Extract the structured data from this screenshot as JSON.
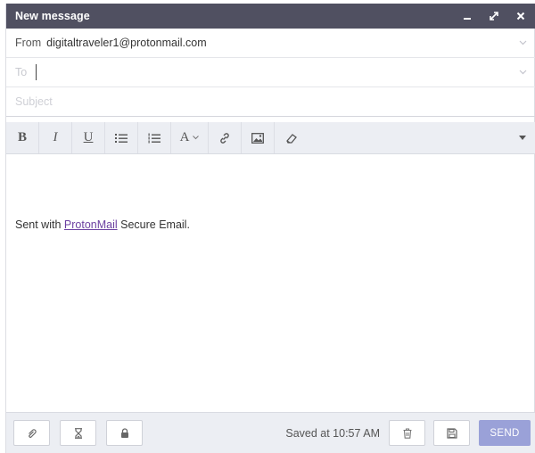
{
  "window": {
    "title": "New message",
    "controls": [
      "minimize-icon",
      "expand-icon",
      "close-icon"
    ]
  },
  "from": {
    "label": "From",
    "value": "digitaltraveler1@protonmail.com"
  },
  "to": {
    "label": "To",
    "value": ""
  },
  "subject": {
    "placeholder": "Subject",
    "value": ""
  },
  "toolbar": {
    "bold": "B",
    "italic": "I",
    "underline": "U",
    "font": "A",
    "icons": [
      "bold-icon",
      "italic-icon",
      "underline-icon",
      "bulleted-list-icon",
      "numbered-list-icon",
      "font-icon",
      "link-icon",
      "image-icon",
      "eraser-icon",
      "caret-down-icon"
    ]
  },
  "body": {
    "signature_prefix": "Sent with ",
    "signature_link": "ProtonMail",
    "signature_suffix": " Secure Email."
  },
  "footer": {
    "icons": [
      "attachment-icon",
      "hourglass-icon",
      "lock-icon",
      "trash-icon",
      "save-icon"
    ],
    "status": "Saved at 10:57 AM",
    "send_label": "SEND"
  },
  "colors": {
    "titlebar": "#505061",
    "send_button": "#9aa1d8",
    "link": "#6b3fa0",
    "toolbar_bg": "#eceef3"
  }
}
